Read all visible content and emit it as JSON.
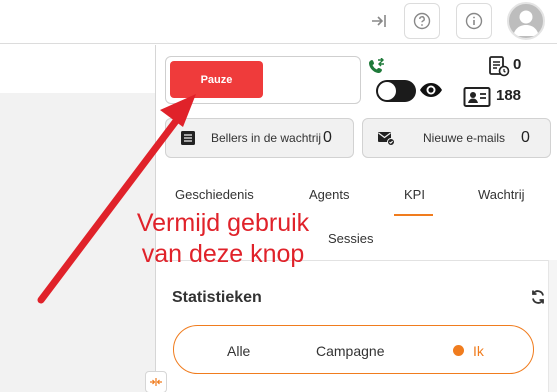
{
  "topbar": {
    "icons": [
      "collapse-right-icon",
      "help-icon",
      "info-icon",
      "user-avatar"
    ]
  },
  "pause": {
    "label": "Pauze",
    "color": "#ef3b3b"
  },
  "status": {
    "toggle_state": "off",
    "icons": [
      "phone-transfer-icon",
      "eye-icon"
    ]
  },
  "counters": [
    {
      "icon": "clipboard-clock-icon",
      "value": "0"
    },
    {
      "icon": "contact-card-icon",
      "value": "188"
    }
  ],
  "queue_cards": [
    {
      "icon": "queue-list-icon",
      "label": "Bellers in de wachtrij",
      "value": "0"
    },
    {
      "icon": "mail-check-icon",
      "label": "Nieuwe e-mails",
      "value": "0"
    }
  ],
  "tabs": {
    "items": [
      "Geschiedenis",
      "Agents",
      "KPI",
      "Wachtrij",
      "Sessies"
    ],
    "active": "KPI"
  },
  "stats": {
    "title": "Statistieken",
    "segments": [
      "Alle",
      "Campagne",
      "Ik"
    ],
    "active_segment": "Ik"
  },
  "annotation": {
    "line1": "Vermijd gebruik",
    "line2": "van deze knop",
    "color": "#e0222a"
  },
  "colors": {
    "accent": "#f07c1e",
    "danger": "#ef3b3b",
    "annotation": "#e0222a"
  }
}
